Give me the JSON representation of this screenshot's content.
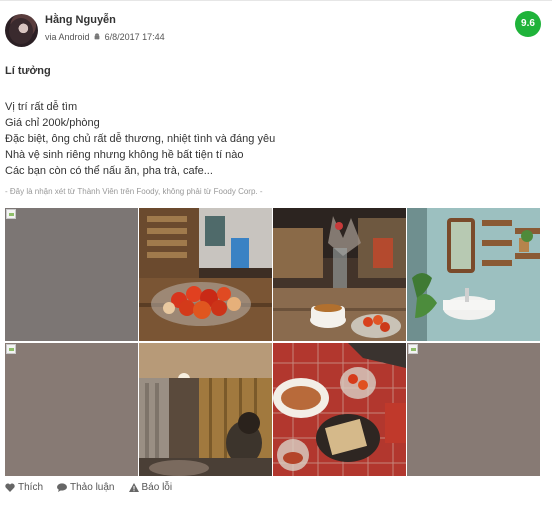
{
  "review": {
    "author": "Hằng Nguyễn",
    "via": "via Android",
    "date": "6/8/2017 17:44",
    "score": "9.6",
    "title": "Lí tưởng",
    "lines": [
      "Vị trí rất dễ tìm",
      "Giá chỉ 200k/phòng",
      "Đặc biệt, ông chủ rất dễ thương, nhiệt tình và đáng yêu",
      "Nhà vệ sinh riêng nhưng không hề bất tiện tí nào",
      "Các bạn còn có thể nấu ăn, pha trà, cafe..."
    ],
    "disclaimer": "- Đây là nhận xét từ Thành Viên trên Foody, không phải từ Foody Corp. -"
  },
  "photos": [
    {
      "kind": "broken",
      "color": "#7c7674"
    },
    {
      "kind": "tomatoes"
    },
    {
      "kind": "teacup"
    },
    {
      "kind": "bathroom"
    },
    {
      "kind": "broken",
      "color": "#877a74"
    },
    {
      "kind": "room"
    },
    {
      "kind": "table-food"
    },
    {
      "kind": "broken",
      "color": "#877a74"
    }
  ],
  "actions": {
    "like": "Thích",
    "discuss": "Thảo luận",
    "report": "Báo lỗi"
  },
  "colors": {
    "score_bg": "#1fb33a"
  }
}
